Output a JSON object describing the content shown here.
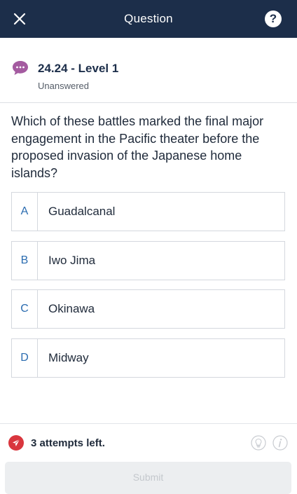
{
  "header": {
    "title": "Question",
    "help_label": "?",
    "background": "#1c2e4a"
  },
  "question": {
    "title": "24.24 - Level 1",
    "status": "Unanswered",
    "icon_color": "#a45ba0",
    "prompt": "Which of these battles marked the final major engagement in the Pacific theater before the proposed invasion of the Japanese home islands?"
  },
  "options": [
    {
      "letter": "A",
      "text": "Guadalcanal"
    },
    {
      "letter": "B",
      "text": "Iwo Jima"
    },
    {
      "letter": "C",
      "text": "Okinawa"
    },
    {
      "letter": "D",
      "text": "Midway"
    }
  ],
  "footer": {
    "attempts": "3 attempts left.",
    "attempts_color": "#d9363e",
    "submit_label": "Submit"
  },
  "icons": {
    "close": "close-icon",
    "help": "help-icon",
    "chat": "chat-bubble-icon",
    "attempts": "paper-plane-icon",
    "hint": "lightbulb-icon",
    "info": "info-icon"
  }
}
